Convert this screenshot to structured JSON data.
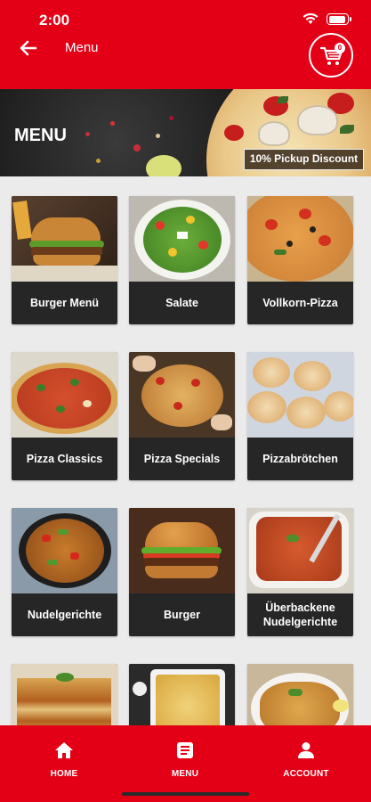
{
  "status_bar": {
    "time": "2:00"
  },
  "header": {
    "title": "Menu",
    "cart_count": "0"
  },
  "banner": {
    "title": "MENU",
    "discount": "10% Pickup Discount"
  },
  "categories": [
    {
      "label": "Burger Menü"
    },
    {
      "label": "Salate"
    },
    {
      "label": "Vollkorn-Pizza"
    },
    {
      "label": "Pizza Classics"
    },
    {
      "label": "Pizza Specials"
    },
    {
      "label": "Pizzabrötchen"
    },
    {
      "label": "Nudelgerichte"
    },
    {
      "label": "Burger"
    },
    {
      "label": "Überbackene Nudelgerichte"
    },
    {
      "label": ""
    },
    {
      "label": ""
    },
    {
      "label": ""
    }
  ],
  "bottom_nav": [
    {
      "label": "HOME",
      "icon": "home-icon"
    },
    {
      "label": "MENU",
      "icon": "menu-icon"
    },
    {
      "label": "ACCOUNT",
      "icon": "account-icon"
    }
  ],
  "colors": {
    "brand_red": "#e30016",
    "card_dark": "#262626",
    "background": "#ebebeb"
  }
}
